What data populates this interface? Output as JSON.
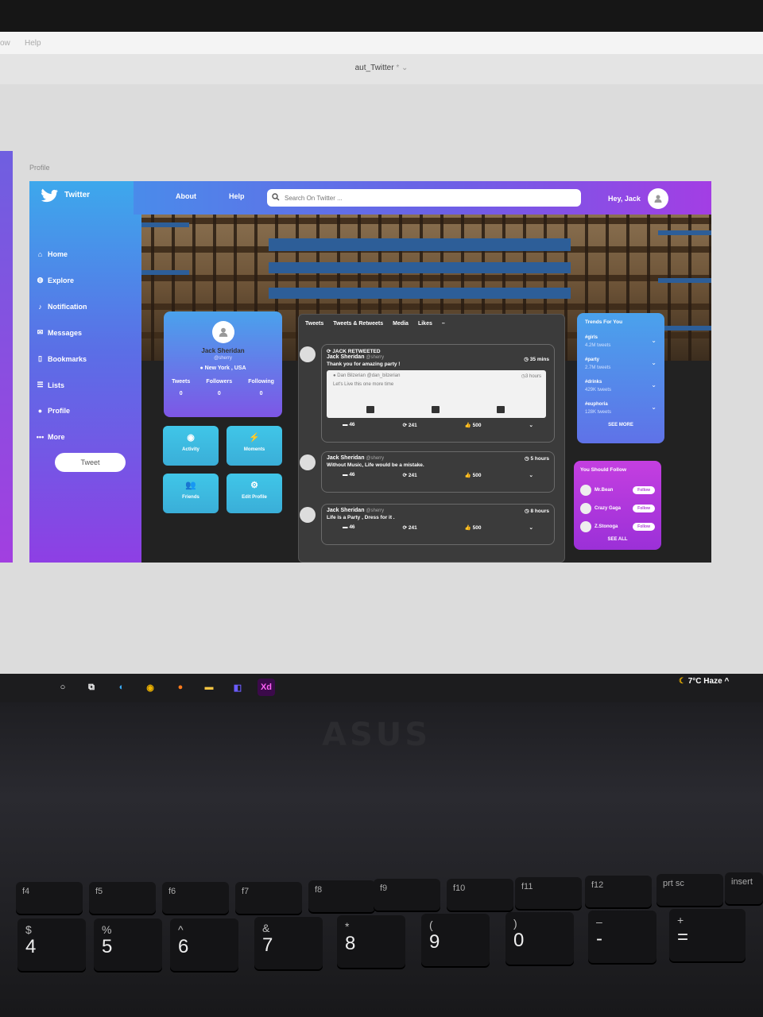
{
  "app": {
    "menu_left": "ow",
    "menu_help": "Help",
    "document_title": "aut_Twitter",
    "document_title_suffix": "* ⌄",
    "artboard_label": "Profile"
  },
  "sidebar": {
    "brand": "Twitter",
    "items": [
      {
        "label": "Home",
        "icon": "home-icon"
      },
      {
        "label": "Explore",
        "icon": "explore-icon"
      },
      {
        "label": "Notification",
        "icon": "bell-icon"
      },
      {
        "label": "Messages",
        "icon": "mail-icon"
      },
      {
        "label": "Bookmarks",
        "icon": "bookmark-icon"
      },
      {
        "label": "Lists",
        "icon": "list-icon"
      },
      {
        "label": "Profile",
        "icon": "user-icon"
      },
      {
        "label": "More",
        "icon": "more-icon"
      }
    ],
    "tweet_button": "Tweet"
  },
  "topbar": {
    "about": "About",
    "help": "Help",
    "search_placeholder": "Search On Twitter ...",
    "greeting": "Hey, Jack"
  },
  "profile": {
    "name": "Jack Sheridan",
    "handle": "@sherry",
    "location": "New York , USA",
    "stats": [
      {
        "label": "Tweets",
        "value": "0"
      },
      {
        "label": "Followers",
        "value": "0"
      },
      {
        "label": "Following",
        "value": "0"
      }
    ],
    "tiles": [
      "Activity",
      "Moments",
      "Friends",
      "Edit Profile"
    ]
  },
  "feed": {
    "tabs": [
      "Tweets",
      "Tweets & Retweets",
      "Media",
      "Likes",
      "–"
    ],
    "tweets": [
      {
        "retweet_label": "JACK RETWEETED",
        "name": "Jack Sheridan",
        "handle": "@sherry",
        "text": "Thank you for amazing party !",
        "time": "35 mins",
        "quote_author": "Dan Bilzerian @dan_bilzerian",
        "quote_time": "3 hours",
        "quote_text": "Let's Live this one more time",
        "comments": "46",
        "retweets": "241",
        "likes": "500"
      },
      {
        "name": "Jack Sheridan",
        "handle": "@sherry",
        "text": "Without Music, Life would be a mistake.",
        "time": "5 hours",
        "comments": "46",
        "retweets": "241",
        "likes": "500"
      },
      {
        "name": "Jack Sheridan",
        "handle": "@sherry",
        "text": "Life is a Party , Dress for it .",
        "time": "8 hours",
        "comments": "46",
        "retweets": "241",
        "likes": "500"
      }
    ]
  },
  "trends": {
    "title": "Trends For You",
    "items": [
      {
        "tag": "#girls",
        "count": "4.2M tweets"
      },
      {
        "tag": "#party",
        "count": "2.7M tweets"
      },
      {
        "tag": "#drinks",
        "count": "429K tweets"
      },
      {
        "tag": "#euphoria",
        "count": "128K tweets"
      }
    ],
    "see_more": "SEE MORE"
  },
  "follow": {
    "title": "You Should Follow",
    "people": [
      {
        "name": "Mr.Bean",
        "button": "Follow"
      },
      {
        "name": "Crazy Gaga",
        "button": "Follow"
      },
      {
        "name": "Z.Stonoga",
        "button": "Follow"
      }
    ],
    "see_all": "SEE ALL"
  },
  "taskbar": {
    "weather": "7°C  Haze",
    "xd_label": "Xd"
  },
  "laptop": {
    "brand": "ASUS",
    "fkeys": [
      "f4",
      "f5",
      "f6",
      "f7",
      "f8",
      "f9",
      "f10",
      "f11",
      "f12",
      "prt sc",
      "insert"
    ],
    "number_keys": [
      {
        "shift": "$",
        "main": "4"
      },
      {
        "shift": "%",
        "main": "5"
      },
      {
        "shift": "^",
        "main": "6"
      },
      {
        "shift": "&",
        "main": "7"
      },
      {
        "shift": "*",
        "main": "8"
      },
      {
        "shift": "(",
        "main": "9"
      },
      {
        "shift": ")",
        "main": "0"
      },
      {
        "shift": "–",
        "main": "-"
      },
      {
        "shift": "+",
        "main": "="
      }
    ]
  },
  "colors": {
    "sidebar_top": "#3da8ec",
    "sidebar_bottom": "#8e3fe4",
    "topbar_end": "#a33ee4",
    "feed_bg": "#3b3b3b",
    "follow_bg": "#c43fe0",
    "tile_bg": "#40c6e8"
  }
}
